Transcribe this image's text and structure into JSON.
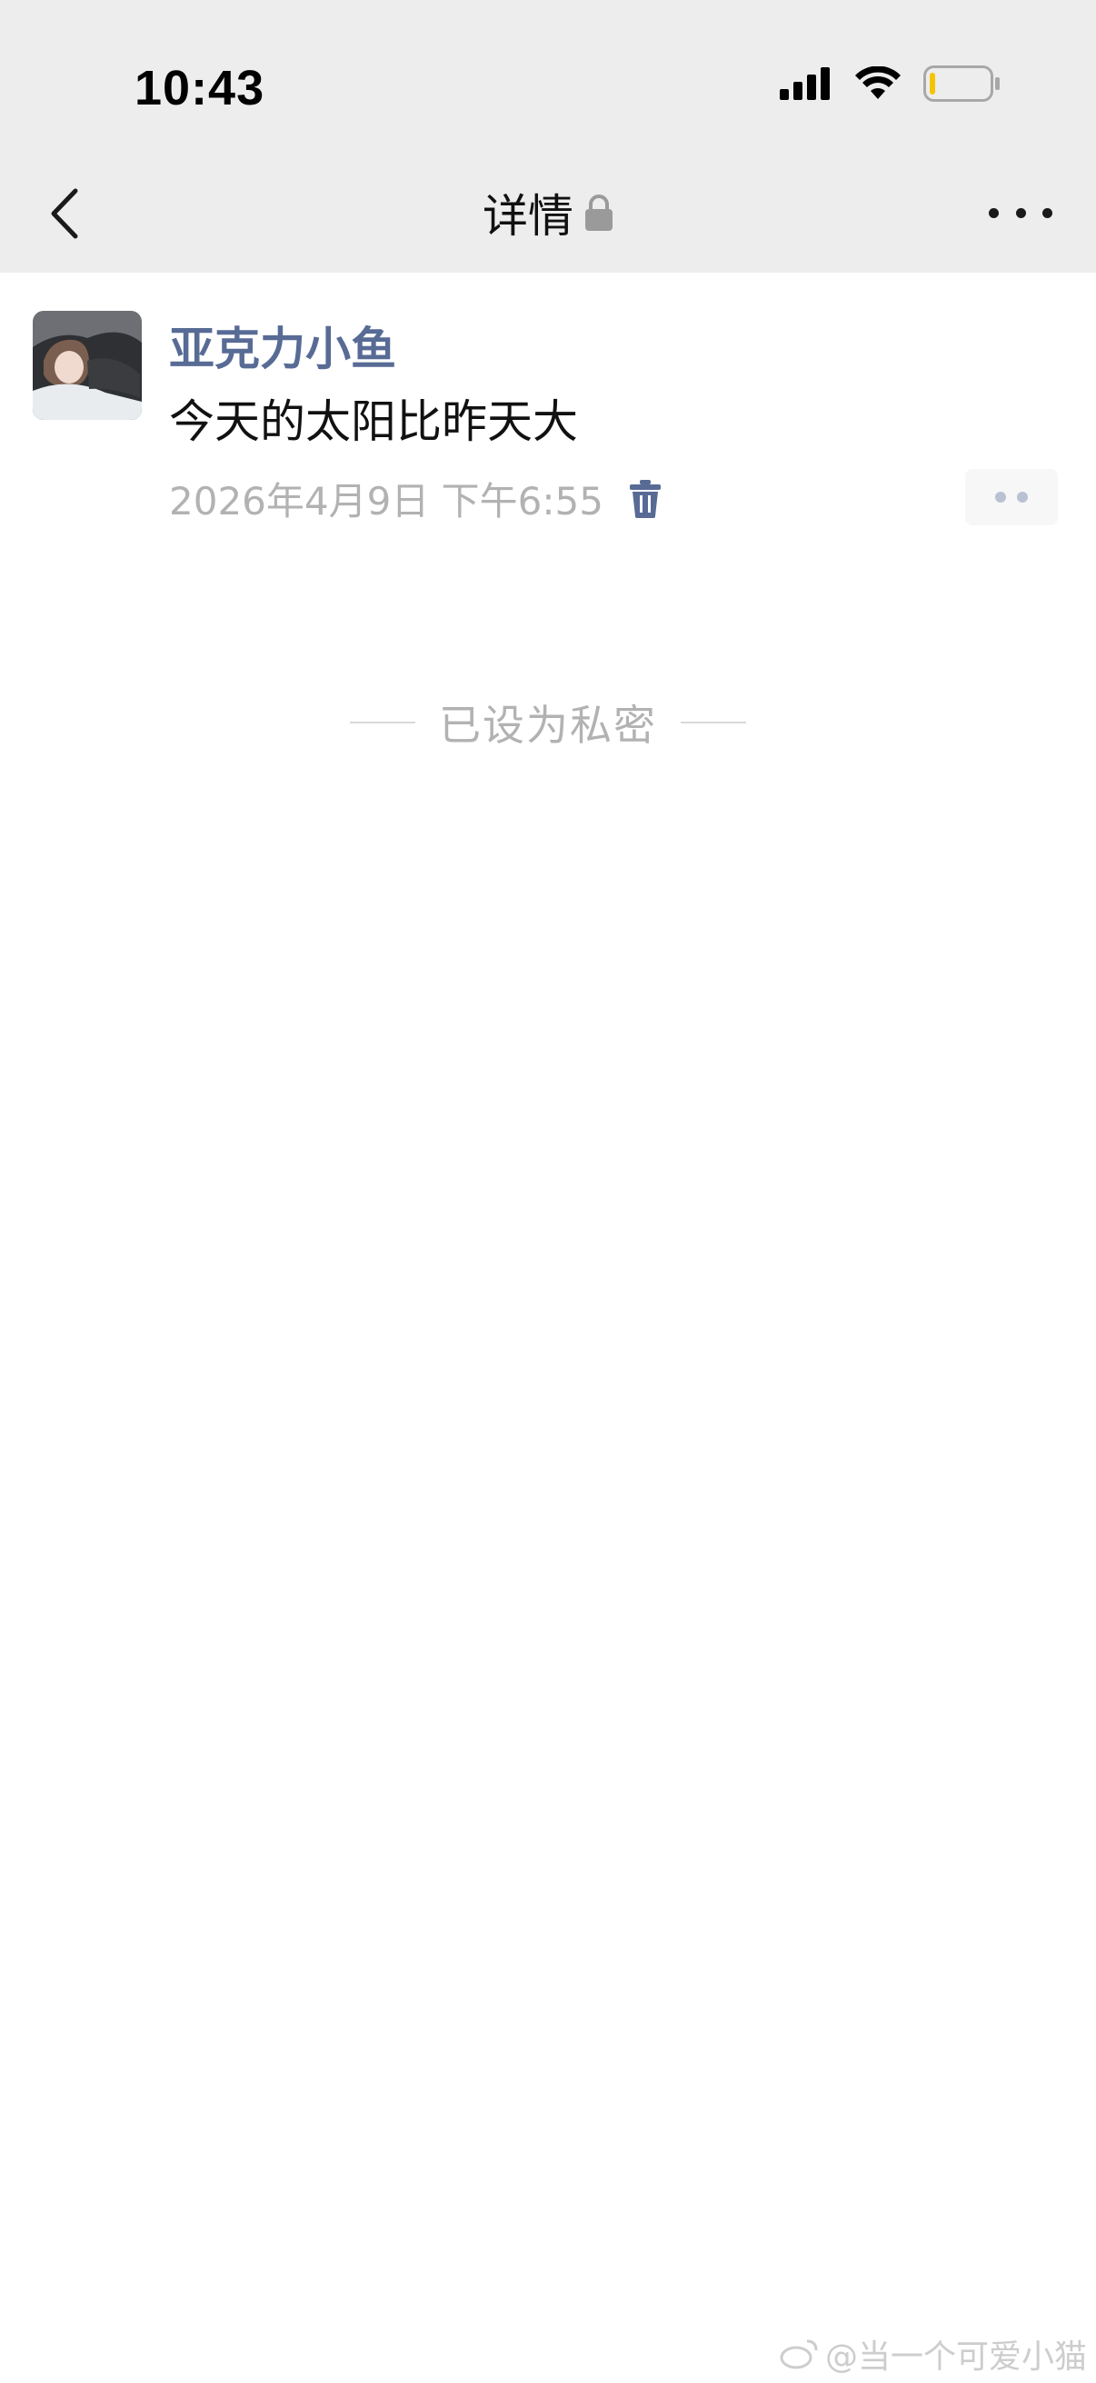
{
  "status_bar": {
    "time": "10:43",
    "icons": [
      "signal-icon",
      "wifi-icon",
      "battery-icon"
    ]
  },
  "nav": {
    "title": "详情",
    "title_icon": "lock-icon",
    "back_icon": "chevron-left-icon",
    "more_icon": "more-icon"
  },
  "post": {
    "username": "亚克力小鱼",
    "text": "今天的太阳比昨天大",
    "timestamp": "2026年4月9日 下午6:55",
    "delete_icon": "trash-icon",
    "action_icon": "more-dots-icon"
  },
  "privacy": {
    "label": "已设为私密"
  },
  "watermark": {
    "text": "@当一个可爱小猫"
  },
  "colors": {
    "nav_bg": "#ededed",
    "username": "#576b95",
    "muted": "#b2b2b2",
    "text": "#111111"
  }
}
